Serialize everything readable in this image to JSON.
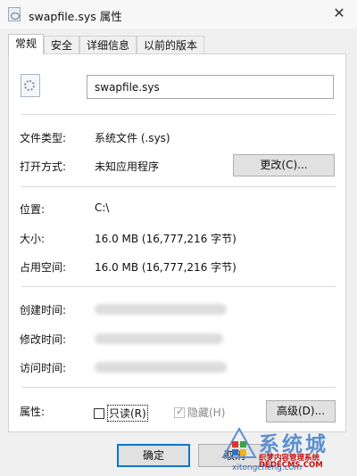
{
  "window": {
    "title": "swapfile.sys 属性",
    "close_glyph": "✕"
  },
  "tabs": [
    {
      "label": "常规",
      "active": true
    },
    {
      "label": "安全",
      "active": false
    },
    {
      "label": "详细信息",
      "active": false
    },
    {
      "label": "以前的版本",
      "active": false
    }
  ],
  "general": {
    "file_icon": "system-file-gear-icon",
    "file_name": "swapfile.sys",
    "type_label": "文件类型:",
    "type_value": "系统文件 (.sys)",
    "open_with_label": "打开方式:",
    "open_with_value": "未知应用程序",
    "change_button": "更改(C)...",
    "location_label": "位置:",
    "location_value": "C:\\",
    "size_label": "大小:",
    "size_value": "16.0 MB (16,777,216 字节)",
    "size_on_disk_label": "占用空间:",
    "size_on_disk_value": "16.0 MB (16,777,216 字节)",
    "created_label": "创建时间:",
    "modified_label": "修改时间:",
    "accessed_label": "访问时间:",
    "attributes_label": "属性:",
    "readonly_label": "只读(R)",
    "readonly_checked": false,
    "hidden_label": "隐藏(H)",
    "hidden_checked": true,
    "hidden_check_glyph": "✓",
    "advanced_button": "高级(D)..."
  },
  "footer": {
    "ok_button": "确定",
    "cancel_button": "取消"
  },
  "watermark": {
    "big_text": "系统城",
    "line1": "织梦内容管理系统",
    "line2": "DEDECMS.COM",
    "url": "xitongcheng.com"
  },
  "colors": {
    "accent": "#0078d7",
    "watermark_blue": "#5d8fd0",
    "watermark_red": "#c01010"
  }
}
